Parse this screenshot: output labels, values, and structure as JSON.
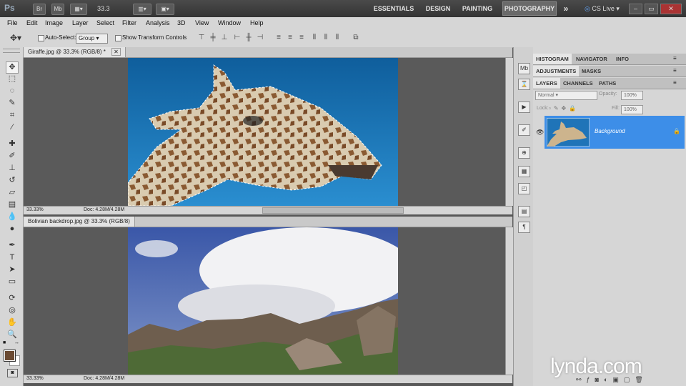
{
  "appbar": {
    "logo": "Ps",
    "bridge_btn": "Br",
    "minibridge_btn": "Mb",
    "zoom": "33.3",
    "workspaces": [
      "ESSENTIALS",
      "DESIGN",
      "PAINTING",
      "PHOTOGRAPHY"
    ],
    "active_workspace": "PHOTOGRAPHY",
    "more": "»",
    "cs_live": "CS Live",
    "win_minimize": "–",
    "win_restore": "▭",
    "win_close": "✕"
  },
  "menu": [
    "File",
    "Edit",
    "Image",
    "Layer",
    "Select",
    "Filter",
    "Analysis",
    "3D",
    "View",
    "Window",
    "Help"
  ],
  "options": {
    "auto_select_label": "Auto-Select:",
    "auto_select_value": "Group",
    "show_transform_label": "Show Transform Controls"
  },
  "doc1": {
    "title": "Giraffe.jpg @ 33.3% (RGB/8) *",
    "zoom": "33.33%",
    "doc_info": "Doc: 4.28M/4.28M"
  },
  "doc2": {
    "title": "Bolivian backdrop.jpg @ 33.3% (RGB/8)",
    "zoom": "33.33%",
    "doc_info": "Doc: 4.28M/4.28M"
  },
  "panels": {
    "group1": [
      "HISTOGRAM",
      "NAVIGATOR",
      "INFO"
    ],
    "group2": [
      "ADJUSTMENTS",
      "MASKS"
    ],
    "group3": [
      "LAYERS",
      "CHANNELS",
      "PATHS"
    ],
    "blend_mode": "Normal",
    "opacity_label": "Opacity:",
    "opacity_value": "100%",
    "lock_label": "Lock:",
    "fill_label": "Fill:",
    "fill_value": "100%",
    "layer_name": "Background"
  },
  "watermark": "lynda.com",
  "colors": {
    "accent_layer": "#3d8ee8",
    "sky_blue": "#1b6fb0",
    "foreground": "#6b4a32"
  }
}
